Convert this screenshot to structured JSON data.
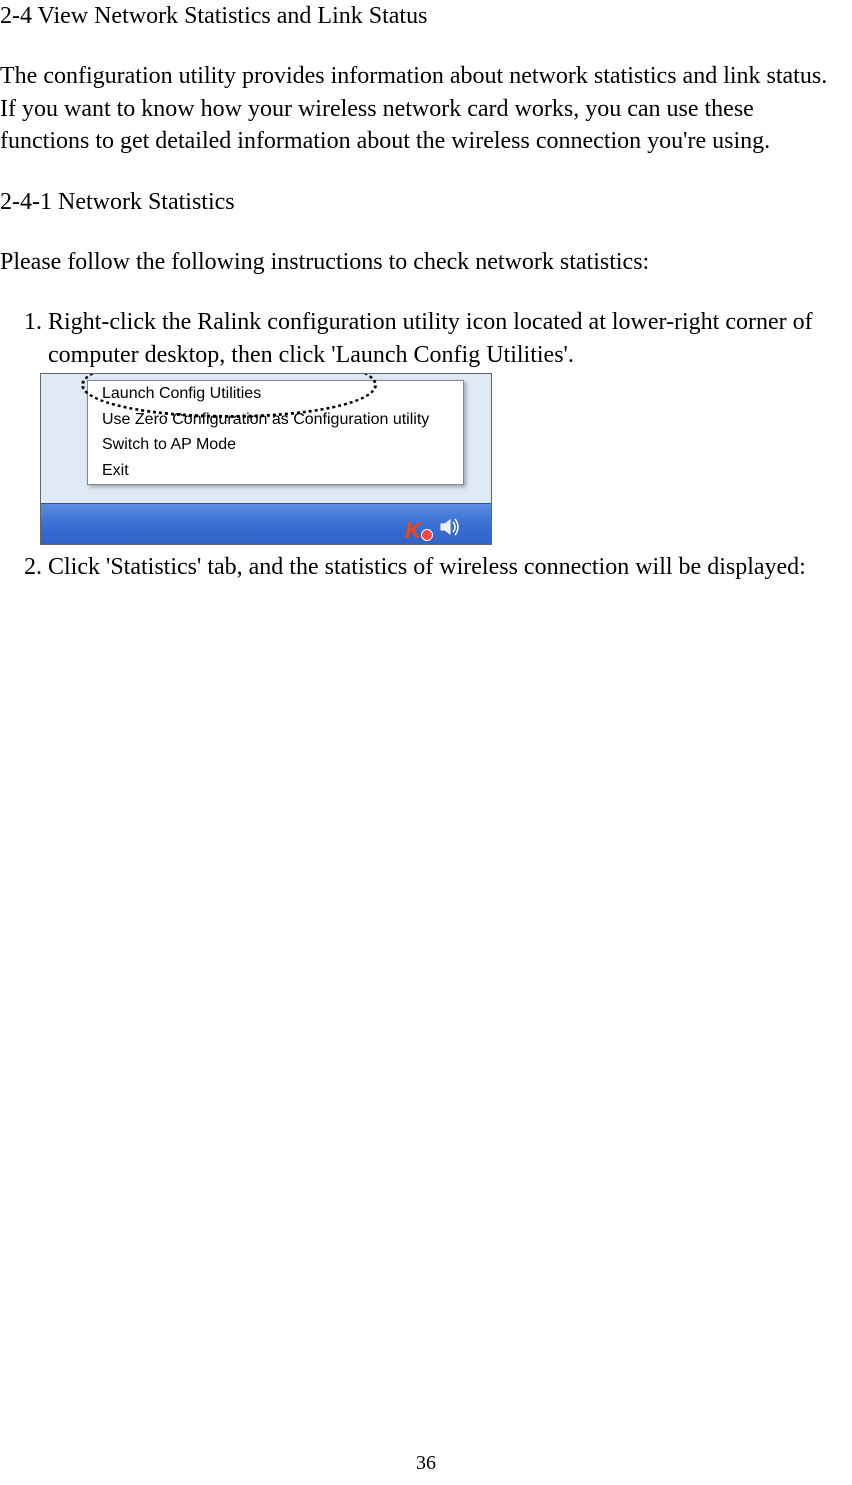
{
  "heading": "2-4  View Network Statistics and Link Status",
  "para1": "The configuration utility provides information about network statistics and link status. If you want to know how your wireless network card works, you can use these functions to get detailed information about the wireless connection you're using.",
  "subheading": "2-4-1 Network Statistics",
  "para2": "Please follow the following instructions to check network statistics:",
  "steps": [
    "Right-click the Ralink configuration utility icon located at lower-right corner of computer desktop, then click 'Launch Config Utilities'.",
    "Click 'Statistics' tab, and the statistics of wireless connection will be displayed:"
  ],
  "contextMenu": {
    "items": [
      "Launch Config Utilities",
      "Use Zero Configuration as Configuration utility",
      "Switch to AP Mode",
      "Exit"
    ]
  },
  "trayIcons": {
    "app": "K",
    "speaker": "speaker-icon"
  },
  "pageNumber": "36"
}
